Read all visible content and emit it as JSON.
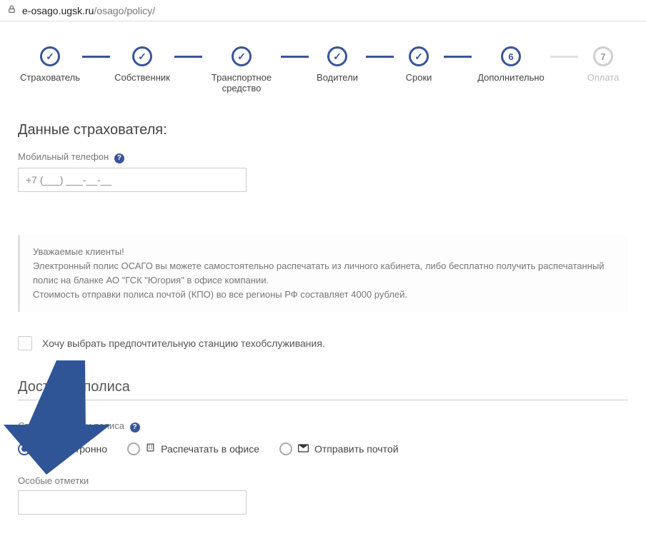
{
  "url": {
    "host": "e-osago.ugsk.ru",
    "path": "/osago/policy/"
  },
  "stepper": {
    "items": [
      {
        "label": "Страхователь",
        "state": "done"
      },
      {
        "label": "Собственник",
        "state": "done"
      },
      {
        "label": "Транспортное\nсредство",
        "state": "done"
      },
      {
        "label": "Водители",
        "state": "done"
      },
      {
        "label": "Сроки",
        "state": "done"
      },
      {
        "label": "Дополнительно",
        "num": "6",
        "state": "current"
      },
      {
        "label": "Оплата",
        "num": "7",
        "state": "disabled"
      }
    ]
  },
  "insurer": {
    "title": "Данные страхователя:",
    "phone_label": "Мобильный телефон",
    "phone_placeholder": "+7 (___) ___-__-__"
  },
  "notice": {
    "greeting": "Уважаемые клиенты!",
    "line1": "Электронный полис ОСАГО вы можете самостоятельно распечатать из личного кабинета, либо бесплатно получить распечатанный полис на бланке АО \"ГСК \"Югория\" в офисе компании.",
    "line2": "Стоимость отправки полиса почтой (КПО) во все регионы РФ составляет 4000 рублей."
  },
  "pref_station_label": "Хочу выбрать предпочтительную станцию техобслуживания.",
  "delivery": {
    "title": "Доставка полиса",
    "method_label": "Способ доставки полиса",
    "options": [
      {
        "label": "Электронно",
        "selected": true
      },
      {
        "label": "Распечатать в офисе",
        "selected": false
      },
      {
        "label": "Отправить почтой",
        "selected": false
      }
    ],
    "special_label": "Особые отметки"
  }
}
